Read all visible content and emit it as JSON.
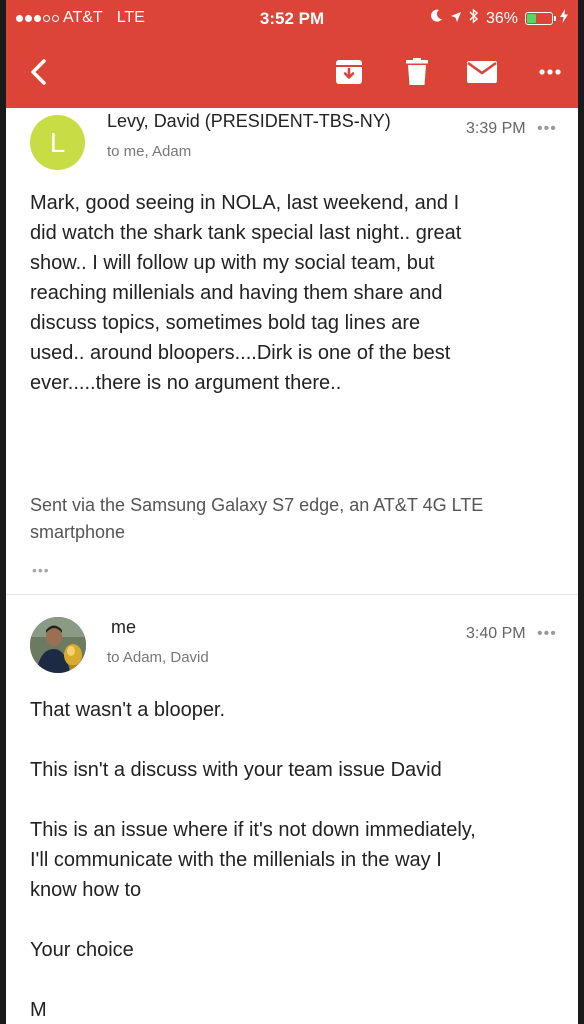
{
  "status_bar": {
    "carrier": "AT&T",
    "network": "LTE",
    "time": "3:52 PM",
    "battery": "36%",
    "battery_level": 0.36,
    "icons": [
      "moon-icon",
      "location-arrow-icon",
      "bluetooth-icon",
      "battery-icon",
      "charging-bolt-icon"
    ]
  },
  "toolbar": {
    "icons": [
      "back-chevron-icon",
      "archive-icon",
      "trash-icon",
      "mail-icon",
      "more-options-icon"
    ]
  },
  "messages": [
    {
      "avatar_letter": "L",
      "avatar_color": "#c8dc45",
      "sender": "Levy, David (PRESIDENT-TBS-NY)",
      "recipients": "to me, Adam",
      "time": "3:39 PM",
      "more": "•••",
      "body_lines": [
        "Mark, good seeing in NOLA, last weekend,  and I",
        "did watch the shark tank special last night.. great",
        "show.. I will follow up with my social team, but",
        "reaching millenials and having them share and",
        "discuss topics, sometimes bold tag lines are",
        "used.. around bloopers....Dirk is one of the best",
        "ever.....there is no argument there.."
      ],
      "signature_lines": [
        "Sent via the Samsung Galaxy S7 edge, an AT&T 4G LTE",
        "smartphone"
      ],
      "trimmed_content": "•••"
    },
    {
      "sender": "me",
      "recipients": "to Adam, David",
      "time": "3:40 PM",
      "more": "•••",
      "paragraphs": [
        "That wasn't a blooper.",
        "This isn't a discuss with your team issue David",
        "This is an issue where if it's not down immediately,",
        "I'll communicate with the millenials in the way I",
        "know how to",
        "Your choice",
        "M"
      ]
    }
  ],
  "colors": {
    "header_red": "#db4437",
    "battery_green": "#4cd964"
  }
}
